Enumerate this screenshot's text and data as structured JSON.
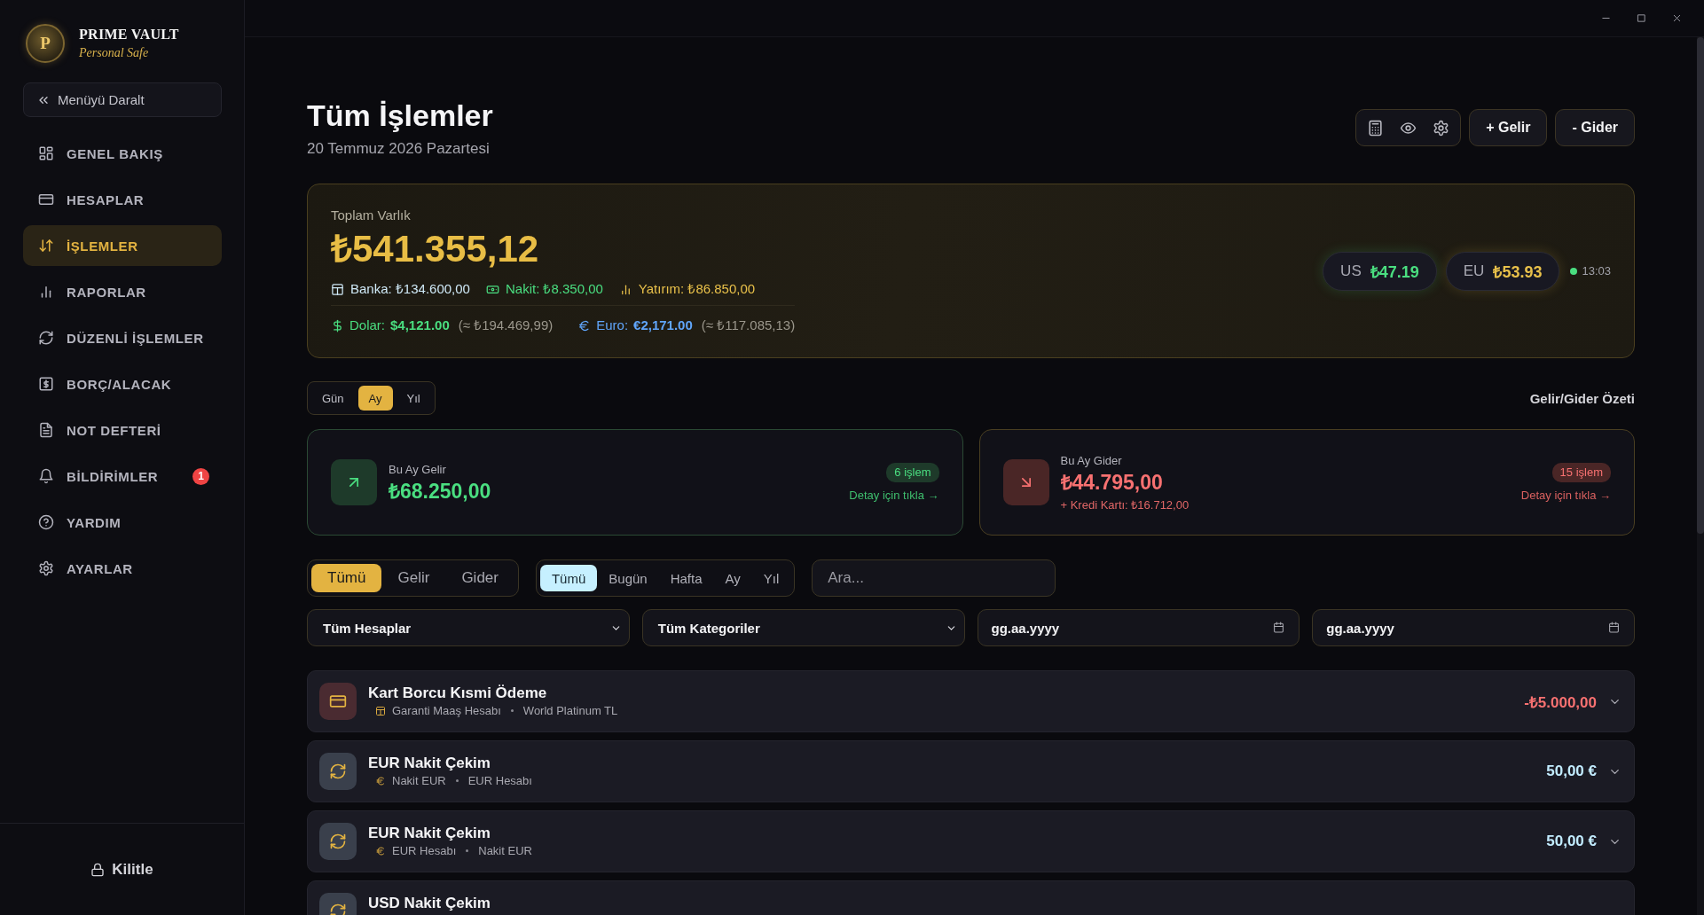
{
  "sidebar": {
    "brand": {
      "monogram": "P",
      "name": "PRIME VAULT",
      "tagline": "Personal Safe"
    },
    "collapse_button": "Menüyü Daralt",
    "items": [
      {
        "label": "GENEL BAKIŞ",
        "selected": false
      },
      {
        "label": "HESAPLAR",
        "selected": false
      },
      {
        "label": "İŞLEMLER",
        "selected": true
      },
      {
        "label": "RAPORLAR",
        "selected": false
      },
      {
        "label": "DÜZENLİ İŞLEMLER",
        "selected": false
      },
      {
        "label": "BORÇ/ALACAK",
        "selected": false
      },
      {
        "label": "NOT DEFTERİ",
        "selected": false
      },
      {
        "label": "BİLDİRİMLER",
        "selected": false,
        "badge": "1"
      },
      {
        "label": "YARDIM",
        "selected": false
      },
      {
        "label": "AYARLAR",
        "selected": false
      }
    ],
    "lock_button": "Kilitle"
  },
  "header": {
    "title": "Tüm İşlemler",
    "date": "20 Temmuz 2026 Pazartesi",
    "buttons": [
      "+ Gelir",
      "- Gider"
    ]
  },
  "total_card": {
    "label": "Toplam Varlık",
    "amount": "₺541.355,12",
    "breakdown": [
      {
        "text": "Banka: ₺134.600,00",
        "color": "#cfe9f7"
      },
      {
        "text": "Nakit: ₺8.350,00",
        "color": "#4ade80"
      },
      {
        "text": "Yatırım: ₺86.850,00",
        "color": "#e8c04a"
      }
    ],
    "currencies": [
      {
        "label": "Dolar:",
        "value": "$4,121.00",
        "approx": "(≈ ₺194.469,99)",
        "color": "#4ade80"
      },
      {
        "label": "Euro:",
        "value": "€2,171.00",
        "approx": "(≈ ₺117.085,13)",
        "color": "#60a5fa"
      }
    ],
    "rates": [
      {
        "code": "US",
        "value": "₺47.19",
        "color": "#4ade80"
      },
      {
        "code": "EU",
        "value": "₺53.93",
        "color": "#e8c04a"
      }
    ],
    "updated": "13:03"
  },
  "period": {
    "options": [
      {
        "label": "Gün",
        "selected": false
      },
      {
        "label": "Ay",
        "selected": true
      },
      {
        "label": "Yıl",
        "selected": false
      }
    ],
    "summary_title": "Gelir/Gider Özeti"
  },
  "summary_cards": [
    {
      "kind": "income",
      "label": "Bu Ay Gelir",
      "amount": "₺68.250,00",
      "count": "6 işlem",
      "link": "Detay için tıkla →"
    },
    {
      "kind": "expense",
      "label": "Bu Ay Gider",
      "amount": "₺44.795,00",
      "note": "+ Kredi Kartı: ₺16.712,00",
      "count": "15 işlem",
      "link": "Detay için tıkla →"
    }
  ],
  "filters": {
    "type_tabs": [
      {
        "label": "Tümü",
        "selected": true
      },
      {
        "label": "Gelir",
        "selected": false
      },
      {
        "label": "Gider",
        "selected": false
      }
    ],
    "range_tabs": [
      {
        "label": "Tümü",
        "selected": true
      },
      {
        "label": "Bugün",
        "selected": false
      },
      {
        "label": "Hafta",
        "selected": false
      },
      {
        "label": "Ay",
        "selected": false
      },
      {
        "label": "Yıl",
        "selected": false
      }
    ],
    "search": {
      "placeholder": "Ara..."
    },
    "selects": [
      {
        "value": "Tüm Hesaplar"
      },
      {
        "value": "Tüm Kategoriler"
      }
    ],
    "date_fields": [
      {
        "placeholder": "gg.aa.yyyy"
      },
      {
        "placeholder": "gg.aa.yyyy"
      }
    ]
  },
  "transactions": [
    {
      "kind": "payment",
      "title": "Kart Borcu Kısmi Ödeme",
      "from": "Garanti Maaş Hesabı",
      "to": "World Platinum TL",
      "amount": "-₺5.000,00"
    },
    {
      "kind": "transfer",
      "title": "EUR Nakit Çekim",
      "from": "Nakit EUR",
      "to": "EUR Hesabı",
      "amount": "50,00 €"
    },
    {
      "kind": "transfer",
      "title": "EUR Nakit Çekim",
      "from": "EUR Hesabı",
      "to": "Nakit EUR",
      "amount": "50,00 €"
    },
    {
      "kind": "transfer",
      "title": "USD Nakit Çekim"
    }
  ]
}
